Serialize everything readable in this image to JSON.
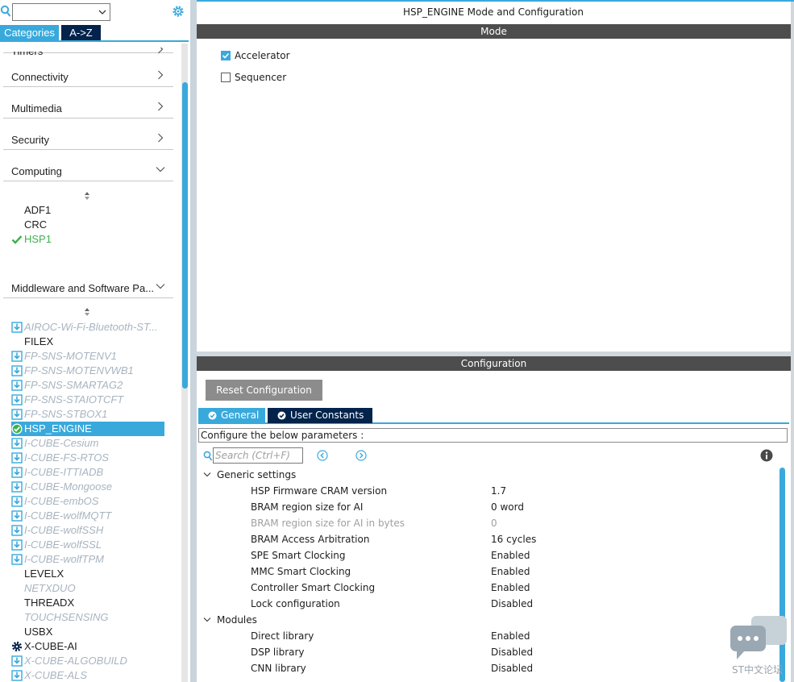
{
  "left_panel": {
    "tabs": {
      "categories": "Categories",
      "az": "A->Z"
    },
    "categories": [
      {
        "label": "Timers",
        "expanded": false
      },
      {
        "label": "Connectivity",
        "expanded": false
      },
      {
        "label": "Multimedia",
        "expanded": false
      },
      {
        "label": "Security",
        "expanded": false
      },
      {
        "label": "Computing",
        "expanded": true
      },
      {
        "label": "Middleware and Software Pa...",
        "expanded": true
      }
    ],
    "computing_items": [
      {
        "label": "ADF1",
        "state": "plain"
      },
      {
        "label": "CRC",
        "state": "plain"
      },
      {
        "label": "HSP1",
        "state": "enabled"
      }
    ],
    "middleware_items": [
      {
        "label": "AIROC-Wi-Fi-Bluetooth-ST...",
        "state": "pack"
      },
      {
        "label": "FILEX",
        "state": "plain"
      },
      {
        "label": "FP-SNS-MOTENV1",
        "state": "pack"
      },
      {
        "label": "FP-SNS-MOTENVWB1",
        "state": "pack"
      },
      {
        "label": "FP-SNS-SMARTAG2",
        "state": "pack"
      },
      {
        "label": "FP-SNS-STAIOTCFT",
        "state": "pack"
      },
      {
        "label": "FP-SNS-STBOX1",
        "state": "pack"
      },
      {
        "label": "HSP_ENGINE",
        "state": "selected"
      },
      {
        "label": "I-CUBE-Cesium",
        "state": "pack"
      },
      {
        "label": "I-CUBE-FS-RTOS",
        "state": "pack"
      },
      {
        "label": "I-CUBE-ITTIADB",
        "state": "pack"
      },
      {
        "label": "I-CUBE-Mongoose",
        "state": "pack"
      },
      {
        "label": "I-CUBE-embOS",
        "state": "pack"
      },
      {
        "label": "I-CUBE-wolfMQTT",
        "state": "pack"
      },
      {
        "label": "I-CUBE-wolfSSH",
        "state": "pack"
      },
      {
        "label": "I-CUBE-wolfSSL",
        "state": "pack"
      },
      {
        "label": "I-CUBE-wolfTPM",
        "state": "pack"
      },
      {
        "label": "LEVELX",
        "state": "plain"
      },
      {
        "label": "NETXDUO",
        "state": "dim"
      },
      {
        "label": "THREADX",
        "state": "plain"
      },
      {
        "label": "TOUCHSENSING",
        "state": "dim"
      },
      {
        "label": "USBX",
        "state": "plain"
      },
      {
        "label": "X-CUBE-AI",
        "state": "gear"
      },
      {
        "label": "X-CUBE-ALGOBUILD",
        "state": "pack"
      },
      {
        "label": "X-CUBE-ALS",
        "state": "pack"
      }
    ]
  },
  "right_panel": {
    "title": "HSP_ENGINE Mode and Configuration",
    "mode_header": "Mode",
    "mode_options": [
      {
        "label": "Accelerator",
        "checked": true
      },
      {
        "label": "Sequencer",
        "checked": false
      }
    ],
    "config_header": "Configuration",
    "reset_button": "Reset Configuration",
    "config_tabs": {
      "general": "General",
      "user_constants": "User Constants"
    },
    "configure_text": "Configure the below parameters :",
    "search_placeholder": "Search (Ctrl+F)",
    "groups": {
      "generic": "Generic settings",
      "modules": "Modules"
    },
    "generic_params": [
      {
        "name": "HSP Firmware CRAM version",
        "value": "1.7",
        "disabled": false
      },
      {
        "name": "BRAM region size for AI",
        "value": "0 word",
        "disabled": false
      },
      {
        "name": "BRAM region size for AI in bytes",
        "value": "0",
        "disabled": true
      },
      {
        "name": "BRAM Access Arbitration",
        "value": "16 cycles",
        "disabled": false
      },
      {
        "name": "SPE Smart Clocking",
        "value": "Enabled",
        "disabled": false
      },
      {
        "name": "MMC Smart Clocking",
        "value": "Enabled",
        "disabled": false
      },
      {
        "name": "Controller Smart Clocking",
        "value": "Enabled",
        "disabled": false
      },
      {
        "name": "Lock configuration",
        "value": "Disabled",
        "disabled": false
      }
    ],
    "module_params": [
      {
        "name": "Direct library",
        "value": "Enabled",
        "disabled": false
      },
      {
        "name": "DSP library",
        "value": "Disabled",
        "disabled": false
      },
      {
        "name": "CNN library",
        "value": "Disabled",
        "disabled": false
      }
    ]
  },
  "watermark": "ST中文论坛",
  "colors": {
    "accent": "#39a9dc",
    "dark_navy": "#03234b",
    "section_bar": "#4d4d4d",
    "enabled_green": "#3db24b"
  }
}
